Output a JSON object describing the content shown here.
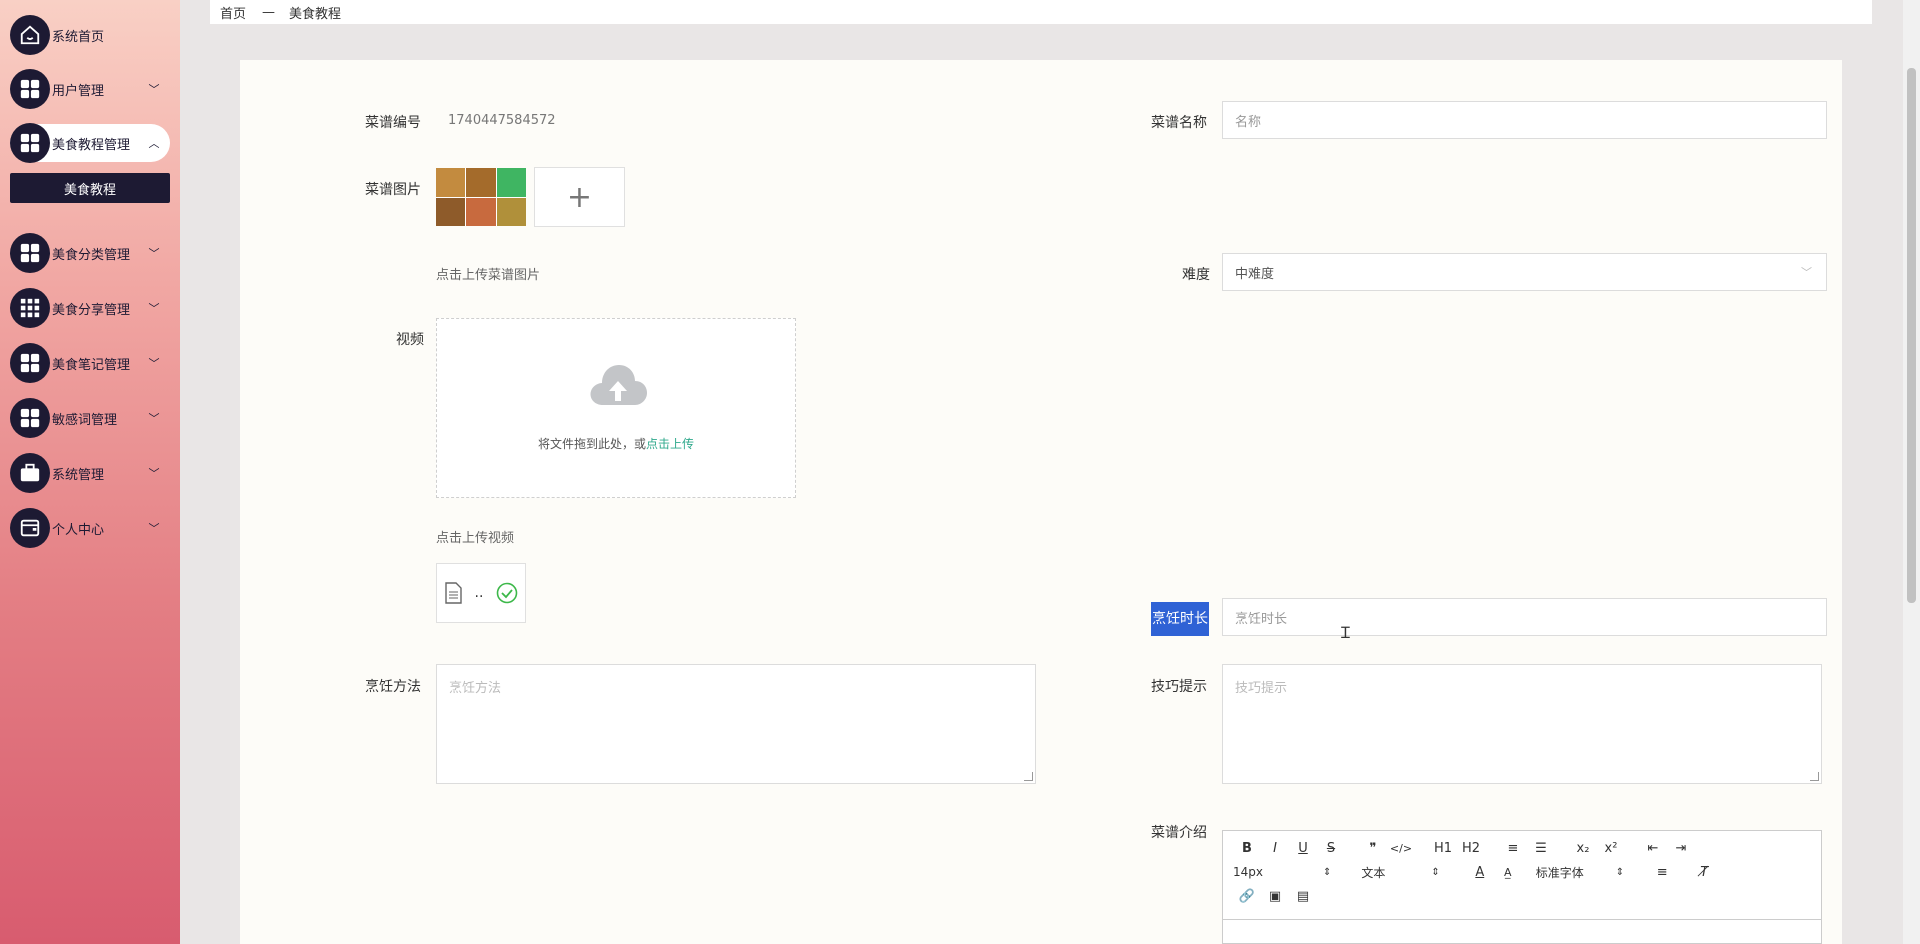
{
  "sidebar": {
    "items": [
      {
        "label": "系统首页",
        "icon": "home-icon",
        "arrow": ""
      },
      {
        "label": "用户管理",
        "icon": "grid-icon",
        "arrow": "﹀"
      },
      {
        "label": "美食教程管理",
        "icon": "grid-icon",
        "arrow": "︿"
      },
      {
        "label": "美食分类管理",
        "icon": "grid-icon",
        "arrow": "﹀"
      },
      {
        "label": "美食分享管理",
        "icon": "apps-icon",
        "arrow": "﹀"
      },
      {
        "label": "美食笔记管理",
        "icon": "grid-icon",
        "arrow": "﹀"
      },
      {
        "label": "敏感词管理",
        "icon": "grid-icon",
        "arrow": "﹀"
      },
      {
        "label": "系统管理",
        "icon": "briefcase-icon",
        "arrow": "﹀"
      },
      {
        "label": "个人中心",
        "icon": "wallet-icon",
        "arrow": "﹀"
      }
    ],
    "submenu": {
      "label": "美食教程"
    }
  },
  "breadcrumb": {
    "home": "首页",
    "separator": "—",
    "current": "美食教程"
  },
  "form": {
    "recipe_no": {
      "label": "菜谱编号",
      "value": "1740447584572"
    },
    "recipe_name": {
      "label": "菜谱名称",
      "placeholder": "名称"
    },
    "recipe_image": {
      "label": "菜谱图片",
      "add_symbol": "+",
      "hint": "点击上传菜谱图片"
    },
    "difficulty": {
      "label": "难度",
      "value": "中难度",
      "arrow": "﹀"
    },
    "video": {
      "label": "视频",
      "drop_text": "将文件拖到此处，或",
      "upload_link": "点击上传",
      "hint": "点击上传视频",
      "file_name": ".."
    },
    "cook_time": {
      "label": "烹饪时长",
      "placeholder": "烹饪时长"
    },
    "cook_method": {
      "label": "烹饪方法",
      "placeholder": "烹饪方法"
    },
    "tips": {
      "label": "技巧提示",
      "placeholder": "技巧提示"
    },
    "intro": {
      "label": "菜谱介绍"
    }
  },
  "editor": {
    "row1": [
      "B",
      "I",
      "U",
      "S",
      "❞",
      "</>",
      "H1",
      "H2",
      "≡",
      "☰",
      "x₂",
      "x²",
      "⇤",
      "⇥"
    ],
    "font_size": "14px",
    "text_type": "文本",
    "font_family": "标准字体",
    "row3": [
      "🔗",
      "▣",
      "▤"
    ]
  }
}
